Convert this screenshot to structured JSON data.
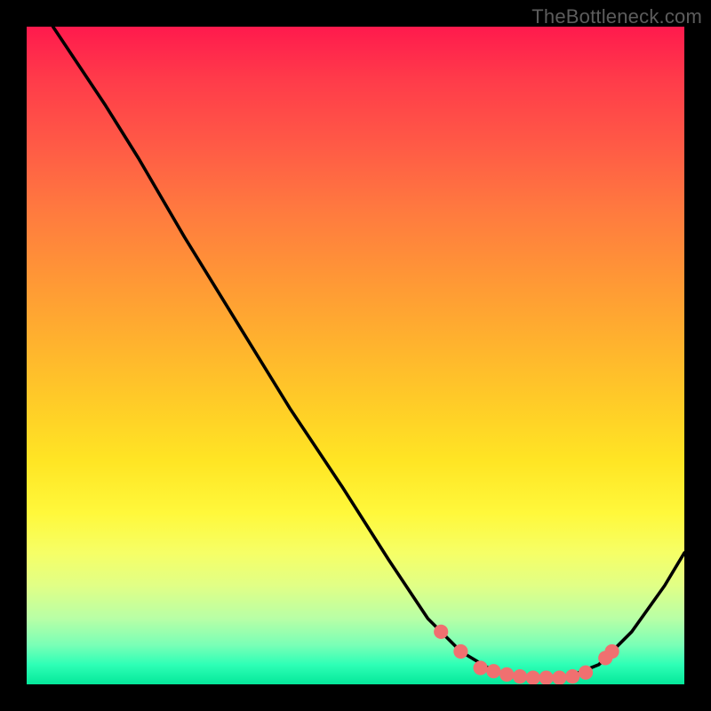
{
  "watermark": "TheBottleneck.com",
  "chart_data": {
    "type": "line",
    "title": "",
    "xlabel": "",
    "ylabel": "",
    "xlim": [
      0,
      100
    ],
    "ylim": [
      0,
      100
    ],
    "grid": false,
    "legend": false,
    "series": [
      {
        "name": "curve",
        "color": "#000000",
        "points": [
          {
            "x": 4,
            "y": 100
          },
          {
            "x": 8,
            "y": 94
          },
          {
            "x": 12,
            "y": 88
          },
          {
            "x": 17,
            "y": 80
          },
          {
            "x": 24,
            "y": 68
          },
          {
            "x": 32,
            "y": 55
          },
          {
            "x": 40,
            "y": 42
          },
          {
            "x": 48,
            "y": 30
          },
          {
            "x": 55,
            "y": 19
          },
          {
            "x": 61,
            "y": 10
          },
          {
            "x": 66,
            "y": 5
          },
          {
            "x": 71,
            "y": 2
          },
          {
            "x": 76,
            "y": 1
          },
          {
            "x": 82,
            "y": 1
          },
          {
            "x": 87,
            "y": 3
          },
          {
            "x": 92,
            "y": 8
          },
          {
            "x": 97,
            "y": 15
          },
          {
            "x": 100,
            "y": 20
          }
        ]
      }
    ],
    "dots": {
      "color": "#f07070",
      "radius_pct": 1.1,
      "points": [
        {
          "x": 63,
          "y": 8
        },
        {
          "x": 66,
          "y": 5
        },
        {
          "x": 69,
          "y": 2.5
        },
        {
          "x": 71,
          "y": 2
        },
        {
          "x": 73,
          "y": 1.5
        },
        {
          "x": 75,
          "y": 1.2
        },
        {
          "x": 77,
          "y": 1
        },
        {
          "x": 79,
          "y": 1
        },
        {
          "x": 81,
          "y": 1
        },
        {
          "x": 83,
          "y": 1.2
        },
        {
          "x": 85,
          "y": 1.8
        },
        {
          "x": 88,
          "y": 4
        },
        {
          "x": 89,
          "y": 5
        }
      ]
    },
    "background_gradient": {
      "top": "#ff1a4d",
      "mid": "#ffe524",
      "bottom": "#05e89a"
    }
  }
}
